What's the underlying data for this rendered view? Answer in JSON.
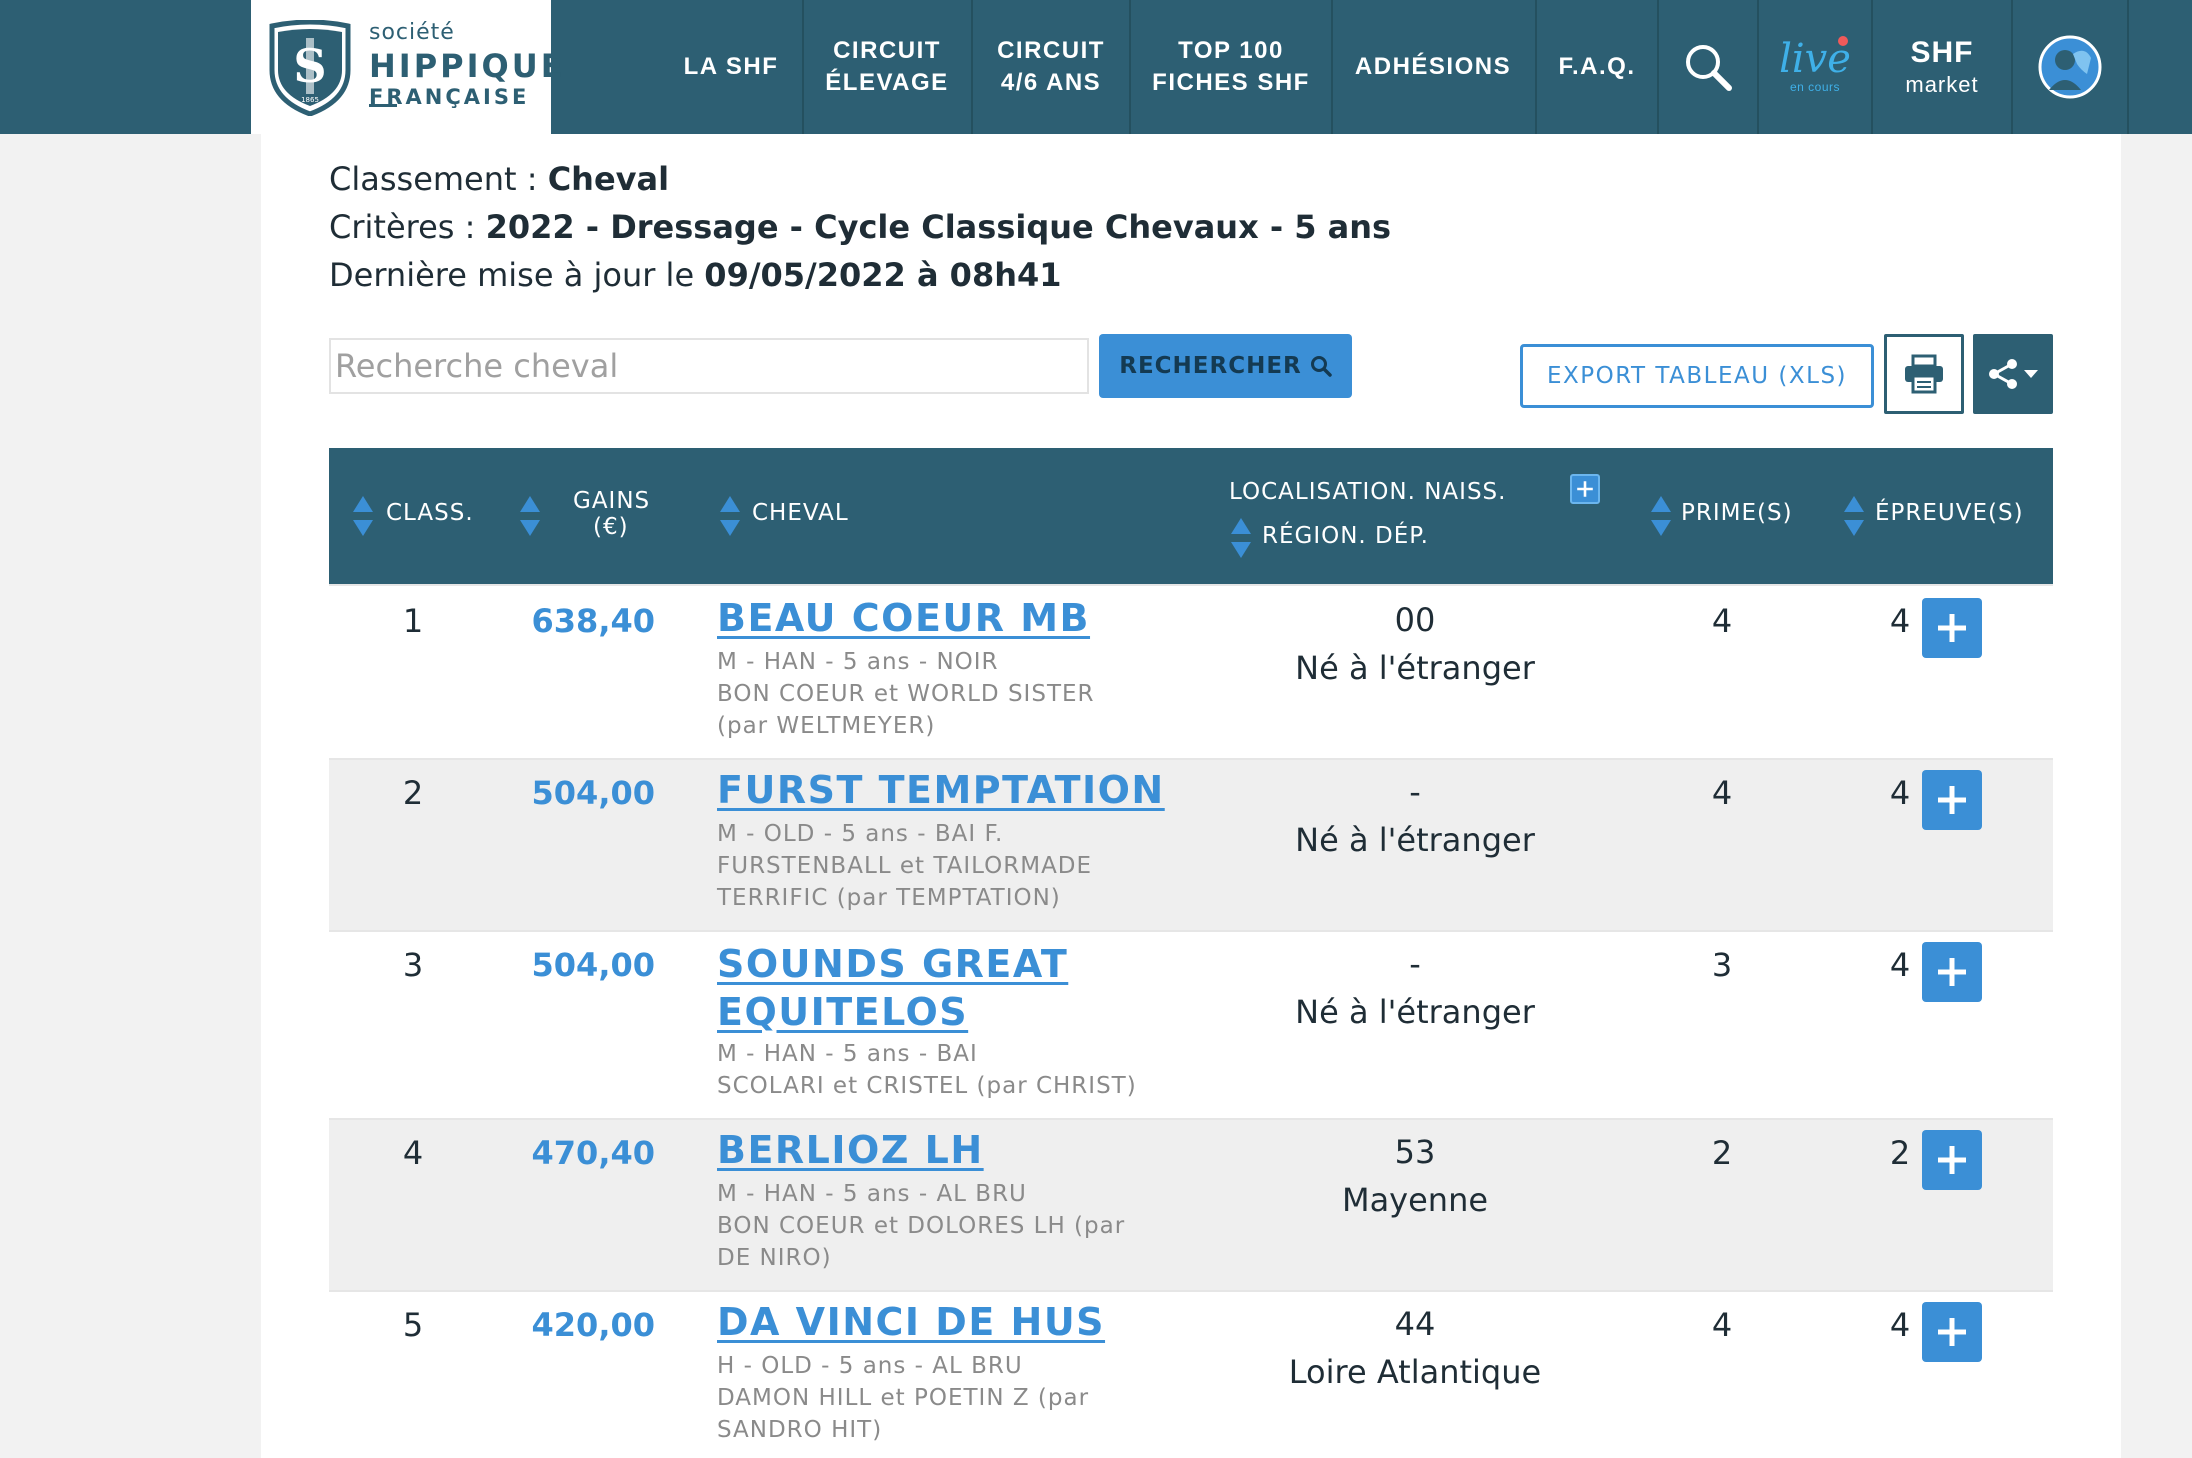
{
  "nav": {
    "logo": {
      "line1": "société",
      "line2": "HIPPIQUE",
      "line3": "FRANÇAISE",
      "year": "1865"
    },
    "items": [
      {
        "line1": "LA SHF",
        "line2": ""
      },
      {
        "line1": "CIRCUIT",
        "line2": "ÉLEVAGE"
      },
      {
        "line1": "CIRCUIT",
        "line2": "4/6 ANS"
      },
      {
        "line1": "TOP 100",
        "line2": "FICHES SHF"
      },
      {
        "line1": "ADHÉSIONS",
        "line2": ""
      },
      {
        "line1": "F.A.Q.",
        "line2": ""
      }
    ],
    "search_icon": "search-icon",
    "live": {
      "word": "live",
      "sub": "en cours"
    },
    "market": {
      "big": "SHF",
      "small": "market"
    },
    "account_icon": "horse-avatar-icon"
  },
  "info": {
    "classement_label": "Classement : ",
    "classement_value": "Cheval",
    "criteres_label": "Critères : ",
    "criteres_value": "2022 - Dressage - Cycle Classique Chevaux - 5 ans",
    "maj_label": "Dernière mise à jour le ",
    "maj_value": "09/05/2022 à 08h41"
  },
  "search": {
    "placeholder": "Recherche cheval",
    "value": "",
    "button": "RECHERCHER"
  },
  "actions": {
    "export": "EXPORT TABLEAU (XLS)",
    "print_icon": "printer-icon",
    "share_icon": "share-icon"
  },
  "table": {
    "headers": {
      "class": "CLASS.",
      "gains_1": "GAINS",
      "gains_2": "(€)",
      "cheval": "CHEVAL",
      "loc_1": "LOCALISATION. NAISS.",
      "loc_2": "RÉGION. DÉP.",
      "primes": "PRIME(S)",
      "epreuves": "ÉPREUVE(S)"
    },
    "rows": [
      {
        "rank": "1",
        "gains": "638,40",
        "name_1": "BEAU COEUR MB",
        "name_2": "",
        "detail_1": "M - HAN - 5 ans - NOIR",
        "detail_2": "BON COEUR et WORLD SISTER",
        "detail_3": "(par WELTMEYER)",
        "dep": "00",
        "region": "Né à l'étranger",
        "primes": "4",
        "epreuves": "4"
      },
      {
        "rank": "2",
        "gains": "504,00",
        "name_1": "FURST TEMPTATION",
        "name_2": "",
        "detail_1": "M - OLD - 5 ans - BAI F.",
        "detail_2": "FURSTENBALL et TAILORMADE",
        "detail_3": "TERRIFIC (par TEMPTATION)",
        "dep": "-",
        "region": "Né à l'étranger",
        "primes": "4",
        "epreuves": "4"
      },
      {
        "rank": "3",
        "gains": "504,00",
        "name_1": "SOUNDS GREAT",
        "name_2": "EQUITELOS",
        "detail_1": "M - HAN - 5 ans - BAI",
        "detail_2": "SCOLARI et CRISTEL (par CHRIST)",
        "detail_3": "",
        "dep": "-",
        "region": "Né à l'étranger",
        "primes": "3",
        "epreuves": "4"
      },
      {
        "rank": "4",
        "gains": "470,40",
        "name_1": "BERLIOZ LH",
        "name_2": "",
        "detail_1": "M - HAN - 5 ans - AL BRU",
        "detail_2": "BON COEUR et DOLORES LH (par",
        "detail_3": "DE NIRO)",
        "dep": "53",
        "region": "Mayenne",
        "primes": "2",
        "epreuves": "2"
      },
      {
        "rank": "5",
        "gains": "420,00",
        "name_1": "DA VINCI DE HUS",
        "name_2": "",
        "detail_1": "H - OLD - 5 ans - AL BRU",
        "detail_2": "DAMON HILL et POETIN Z (par",
        "detail_3": "SANDRO HIT)",
        "dep": "44",
        "region": "Loire Atlantique",
        "primes": "4",
        "epreuves": "4"
      }
    ]
  },
  "colors": {
    "nav": "#2d5f73",
    "accent": "#3b8fd6",
    "row_alt": "#efefef"
  }
}
